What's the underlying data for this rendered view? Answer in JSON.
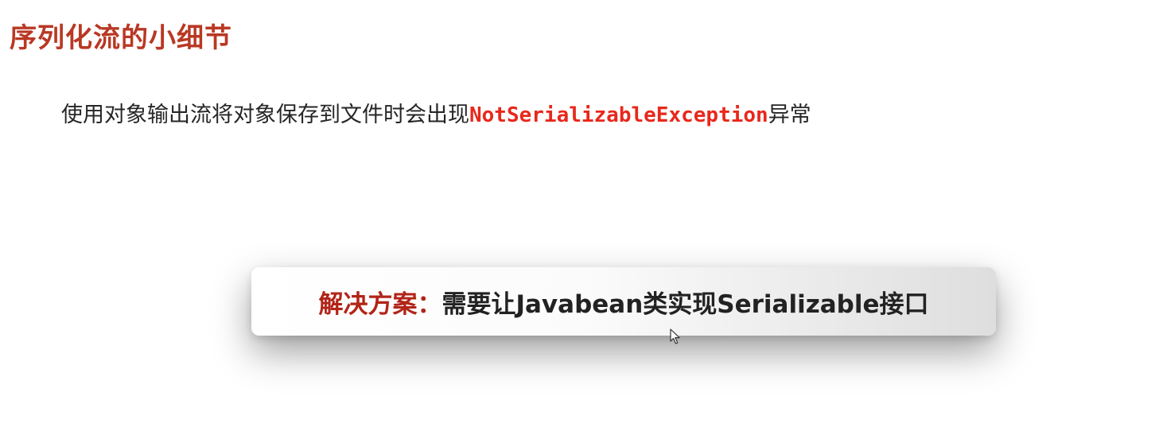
{
  "slide": {
    "title": "序列化流的小细节",
    "bullet": {
      "prefix": "使用对象输出流将对象保存到文件时会出现",
      "exception": "NotSerializableException",
      "suffix": "异常"
    },
    "solution": {
      "label": "解决方案：",
      "text": "需要让Javabean类实现Serializable接口"
    }
  },
  "colors": {
    "title": "#b93824",
    "exception": "#e8281c",
    "solution_label": "#b22418"
  },
  "icons": {
    "cursor": "mouse-pointer-icon"
  }
}
